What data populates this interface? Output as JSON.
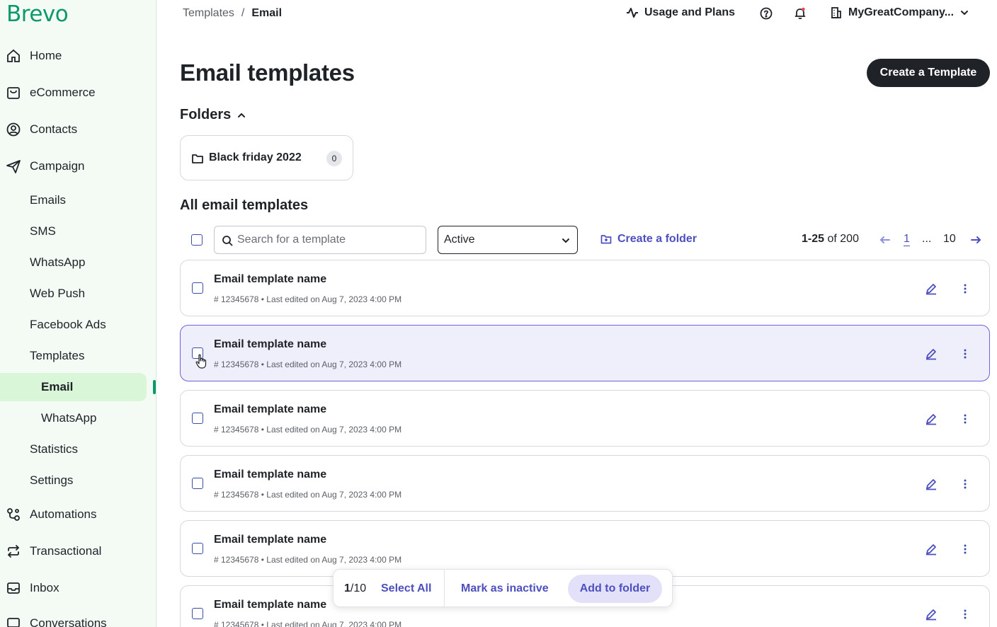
{
  "brand": {
    "logo_text": "Brevo",
    "accent": "#0b996e",
    "link_color": "#4d4fbf"
  },
  "sidebar": {
    "items": [
      {
        "label": "Home",
        "icon": "home-icon"
      },
      {
        "label": "eCommerce",
        "icon": "shopping-bag-icon"
      },
      {
        "label": "Contacts",
        "icon": "contact-icon"
      },
      {
        "label": "Campaign",
        "icon": "paper-plane-icon"
      },
      {
        "label": "Emails"
      },
      {
        "label": "SMS"
      },
      {
        "label": "WhatsApp"
      },
      {
        "label": "Web Push"
      },
      {
        "label": "Facebook Ads"
      },
      {
        "label": "Templates"
      },
      {
        "label": "Email",
        "active": true
      },
      {
        "label": "WhatsApp"
      },
      {
        "label": "Statistics"
      },
      {
        "label": "Settings"
      },
      {
        "label": "Automations",
        "icon": "automation-icon"
      },
      {
        "label": "Transactional",
        "icon": "repeat-icon"
      },
      {
        "label": "Inbox",
        "icon": "inbox-icon"
      },
      {
        "label": "Conversations",
        "icon": "chat-icon"
      }
    ]
  },
  "header": {
    "breadcrumb": [
      "Templates",
      "/",
      "Email"
    ],
    "usage_label": "Usage and Plans",
    "company_name": "MyGreatCompany..."
  },
  "main": {
    "title": "Email templates",
    "create_button": "Create a Template",
    "folders_heading": "Folders",
    "folders": [
      {
        "name": "Black friday 2022",
        "count": "0"
      }
    ],
    "all_heading": "All email templates",
    "search_placeholder": "Search for a template",
    "status_filter": "Active",
    "create_folder_label": "Create a folder",
    "pagination": {
      "range": "1-25",
      "of_text": "of 200",
      "current": "1",
      "ellipsis": "...",
      "last": "10"
    },
    "templates": [
      {
        "name": "Email template name",
        "meta": "# 12345678  •  Last edited on Aug 7, 2023 4:00 PM"
      },
      {
        "name": "Email template name",
        "meta": "# 12345678  •  Last edited on Aug 7, 2023 4:00 PM"
      },
      {
        "name": "Email template name",
        "meta": "# 12345678  •  Last edited on Aug 7, 2023 4:00 PM"
      },
      {
        "name": "Email template name",
        "meta": "# 12345678  •  Last edited on Aug 7, 2023 4:00 PM"
      },
      {
        "name": "Email template name",
        "meta": "# 12345678  •  Last edited on Aug 7, 2023 4:00 PM"
      },
      {
        "name": "Email template name",
        "meta": "# 12345678  •  Last edited on Aug 7, 2023 4:00 PM"
      }
    ]
  },
  "action_bar": {
    "selected": "1",
    "total": "/10",
    "select_all": "Select All",
    "mark_inactive": "Mark as inactive",
    "add_to_folder": "Add to folder"
  }
}
